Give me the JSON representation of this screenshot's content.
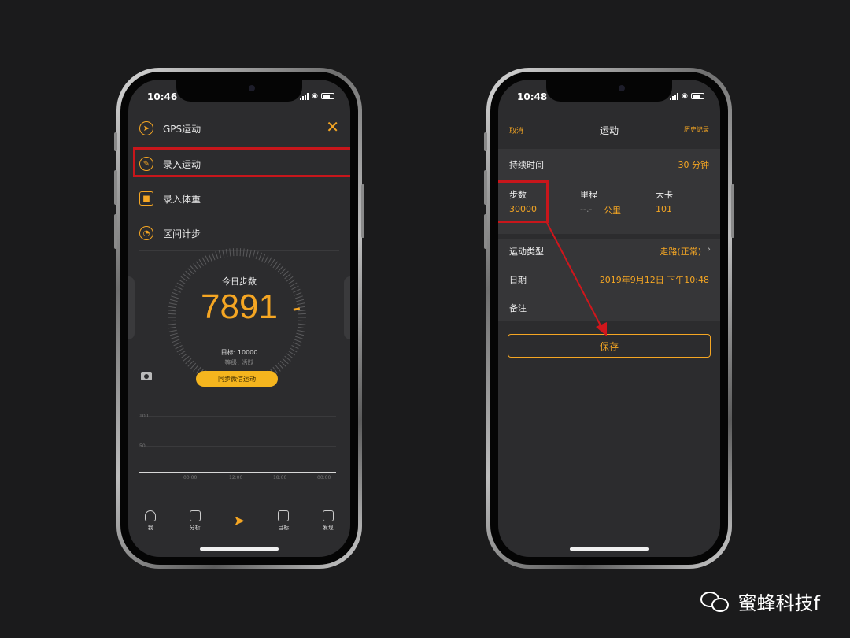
{
  "left_phone": {
    "time": "10:46",
    "menu": [
      {
        "label": "GPS运动",
        "icon": "running-icon"
      },
      {
        "label": "录入运动",
        "icon": "pencil-icon"
      },
      {
        "label": "录入体重",
        "icon": "scale-icon"
      },
      {
        "label": "区间计步",
        "icon": "speedometer-icon"
      }
    ],
    "steps_title": "今日步数",
    "steps_value": "7891",
    "goal": "目标: 10000",
    "level": "等级: 活跃",
    "sync_button": "同步微信运动",
    "chart_axis": {
      "y100": "100",
      "y50": "50",
      "x": [
        "00:00",
        "12:00",
        "18:00",
        "00:00"
      ]
    },
    "tabs": [
      {
        "label": "我",
        "icon": "person-icon"
      },
      {
        "label": "分析",
        "icon": "bar-chart-icon"
      },
      {
        "label": "",
        "icon": "shoe-icon"
      },
      {
        "label": "目标",
        "icon": "checkbox-icon"
      },
      {
        "label": "发现",
        "icon": "dice-icon"
      }
    ]
  },
  "right_phone": {
    "time": "10:48",
    "nav": {
      "cancel": "取消",
      "title": "运动",
      "history": "历史记录"
    },
    "duration": {
      "label": "持续时间",
      "value": "30 分钟"
    },
    "steps": {
      "label": "步数",
      "value": "30000"
    },
    "distance": {
      "label": "里程",
      "value": "--.-",
      "unit": "公里"
    },
    "calories": {
      "label": "大卡",
      "value": "101"
    },
    "sport_type": {
      "label": "运动类型",
      "value": "走路(正常)"
    },
    "date": {
      "label": "日期",
      "value": "2019年9月12日 下午10:48"
    },
    "note": {
      "label": "备注"
    },
    "save_button": "保存"
  },
  "watermark": "蜜蜂科技f",
  "colors": {
    "accent": "#f5a623",
    "highlight": "#c8161b",
    "screen_bg": "#2c2c2e"
  }
}
